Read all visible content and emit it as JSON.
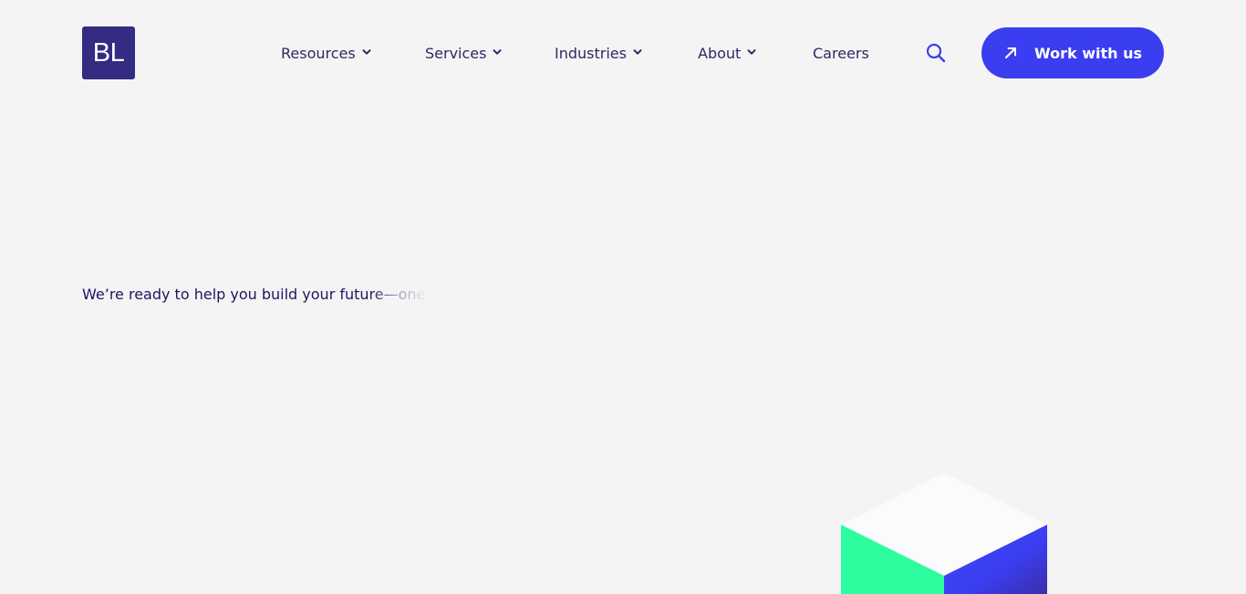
{
  "header": {
    "logo_text": "BL",
    "nav": [
      {
        "label": "Resources",
        "has_dropdown": true
      },
      {
        "label": "Services",
        "has_dropdown": true
      },
      {
        "label": "Industries",
        "has_dropdown": true
      },
      {
        "label": "About",
        "has_dropdown": true
      },
      {
        "label": "Careers",
        "has_dropdown": false
      }
    ],
    "search_icon": "search-icon",
    "cta_label": "Work with us",
    "cta_icon": "arrow-up-right-icon"
  },
  "hero": {
    "text_visible": "We’re ready to help you build your futu",
    "text_fading": "re—one"
  },
  "colors": {
    "background": "#f4f4f5",
    "logo_bg": "#342b83",
    "nav_text": "#2b2a63",
    "accent": "#3b3df1",
    "hero_text": "#1d1660",
    "cube_top": "#fbfbfb",
    "cube_left": "#2dfd9f",
    "cube_right": "#3b3df1"
  }
}
